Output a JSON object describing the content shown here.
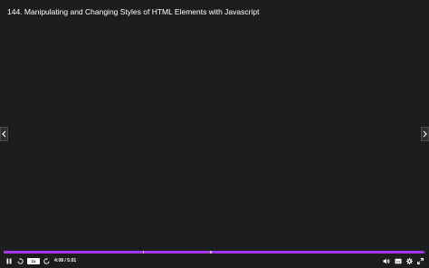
{
  "lecture": {
    "title": "144. Manipulating and Changing Styles of HTML Elements with Javascript"
  },
  "navigation": {
    "prev_icon": "chevron-left-icon",
    "next_icon": "chevron-right-icon"
  },
  "player": {
    "progress_fraction": 0.995,
    "marker_fractions": [
      0.33,
      0.49
    ],
    "speed_label": "1x",
    "time_display": "4:08 / 5:01",
    "icons": {
      "play_pause": "pause-icon",
      "rewind": "rewind-5-icon",
      "forward": "forward-5-icon",
      "volume": "volume-icon",
      "captions": "captions-icon",
      "settings": "gear-icon",
      "fullscreen": "expand-icon"
    }
  },
  "colors": {
    "background": "#1c1d1f",
    "progress_accent": "#a435f0",
    "text": "#ffffff"
  }
}
